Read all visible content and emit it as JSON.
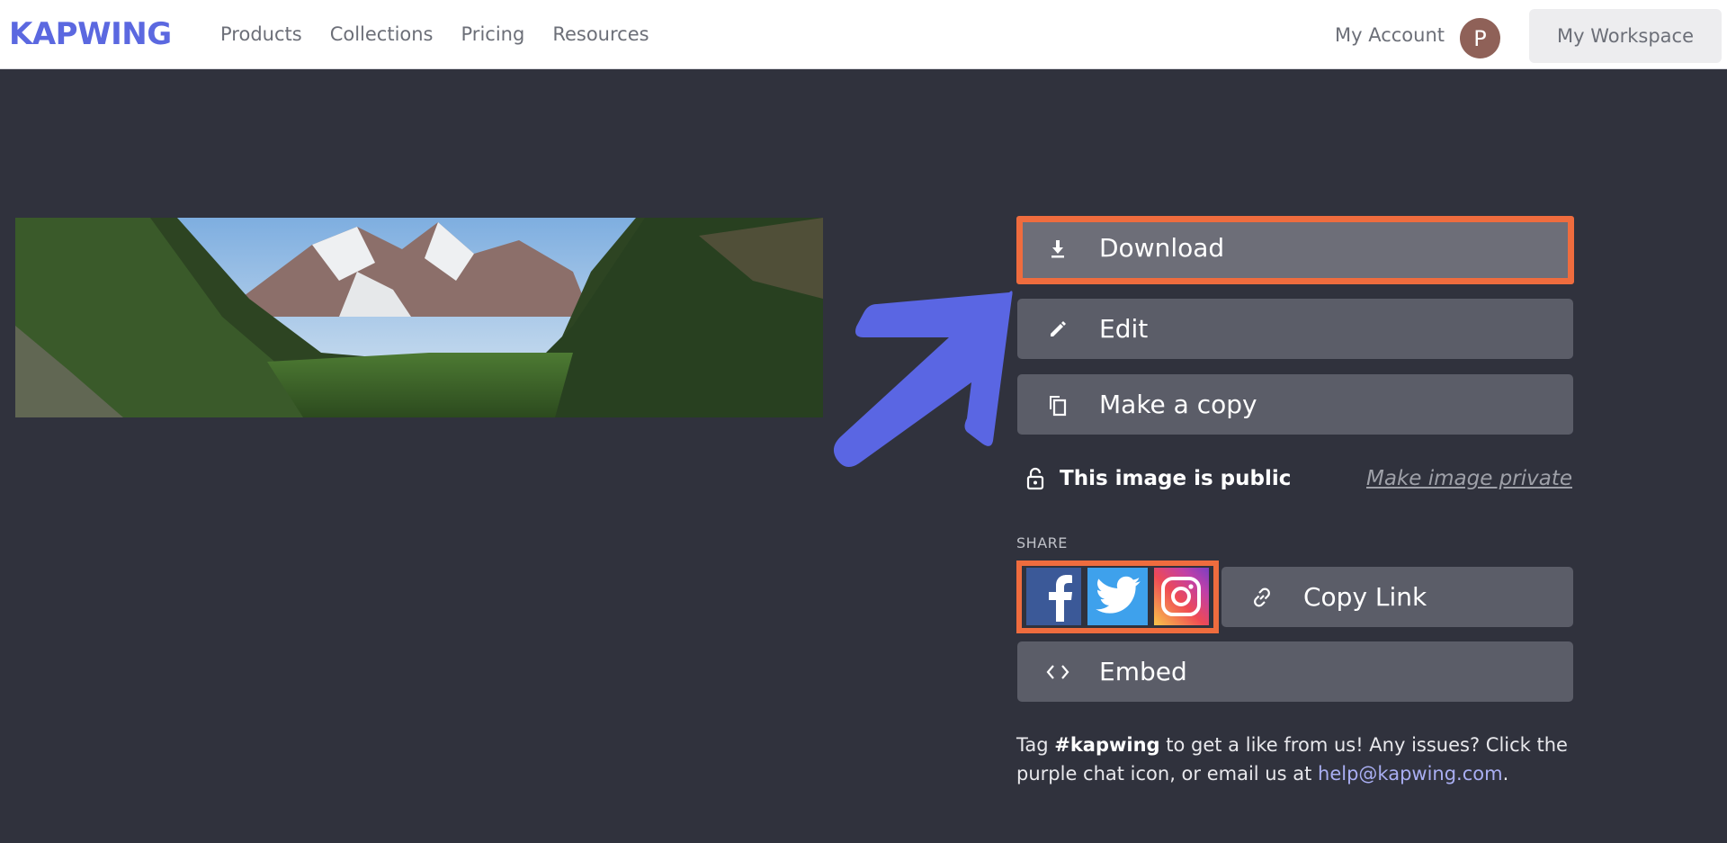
{
  "header": {
    "logo": "KAPWING",
    "nav": [
      "Products",
      "Collections",
      "Pricing",
      "Resources"
    ],
    "account_label": "My Account",
    "avatar_initial": "P",
    "workspace_label": "My Workspace"
  },
  "actions": {
    "download": "Download",
    "edit": "Edit",
    "copy": "Make a copy",
    "public_status": "This image is public",
    "make_private": "Make image private",
    "share_label": "SHARE",
    "copy_link": "Copy Link",
    "embed": "Embed"
  },
  "footer": {
    "text_before": "Tag ",
    "hashtag": "#kapwing",
    "text_middle": " to get a like from us! Any issues? Click the purple chat icon, or email us at ",
    "email": "help@kapwing.com",
    "text_end": "."
  },
  "colors": {
    "brand": "#5b68e0",
    "highlight": "#ef6c3e",
    "background": "#30323d",
    "button": "#5b5d68"
  },
  "icons": [
    "download-icon",
    "pencil-icon",
    "copy-icon",
    "lock-icon",
    "facebook-icon",
    "twitter-icon",
    "instagram-icon",
    "link-icon",
    "code-icon",
    "arrow-annotation"
  ]
}
